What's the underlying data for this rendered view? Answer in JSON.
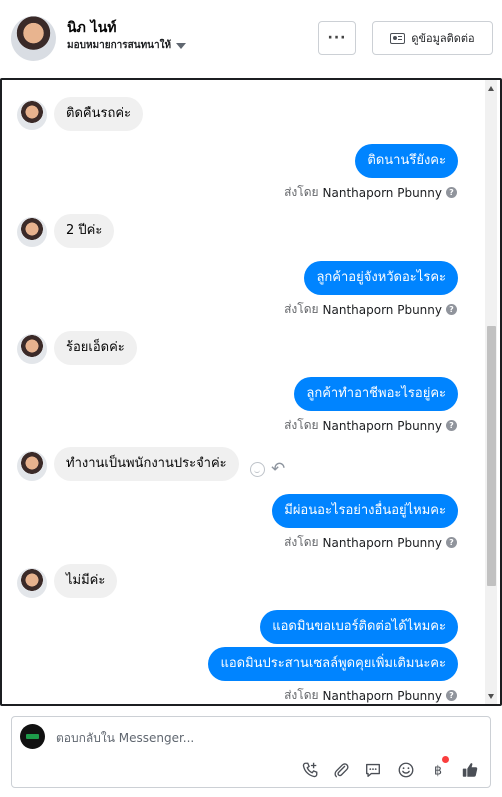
{
  "header": {
    "name": "นิภ ไนท์",
    "assign_label": "มอบหมายการสนทนาให้",
    "more_label": "···",
    "contact_button": "ดูข้อมูลติดต่อ"
  },
  "conversation": {
    "sent_by_prefix": "ส่งโดย",
    "sender_name": "Nanthaporn Pbunny",
    "messages": [
      {
        "direction": "in",
        "text": "ติดคืนรถค่ะ"
      },
      {
        "direction": "out",
        "text": "ติดนานรึยังคะ"
      },
      {
        "direction": "in",
        "text": "2 ปีค่ะ"
      },
      {
        "direction": "out",
        "text": "ลูกค้าอยู่จังหวัดอะไรคะ"
      },
      {
        "direction": "in",
        "text": "ร้อยเอ็ดค่ะ"
      },
      {
        "direction": "out",
        "text": "ลูกค้าทำอาชีพอะไรอยู่คะ"
      },
      {
        "direction": "in",
        "text": "ทำงานเป็นพนักงานประจำค่ะ"
      },
      {
        "direction": "out",
        "text": "มีผ่อนอะไรอย่างอื่นอยู่ไหมคะ"
      },
      {
        "direction": "in",
        "text": "ไม่มีค่ะ"
      },
      {
        "direction": "out",
        "text": "แอดมินขอเบอร์ติดต่อได้ไหมคะ"
      },
      {
        "direction": "out",
        "text": "แอดมินประสานเซลล์พูดคุยเพิ่มเติมนะคะ"
      }
    ]
  },
  "composer": {
    "placeholder": "ตอบกลับใน Messenger..."
  },
  "icons": {
    "call": "phone-plus-icon",
    "attach": "paperclip-icon",
    "saved_replies": "chat-bubble-icon",
    "emoji": "smiley-icon",
    "payment": "baht-icon",
    "like": "thumbs-up-icon"
  },
  "colors": {
    "outgoing_bubble": "#0084ff",
    "incoming_bubble": "#f0f0f0",
    "notification_dot": "#fa3e3e"
  }
}
